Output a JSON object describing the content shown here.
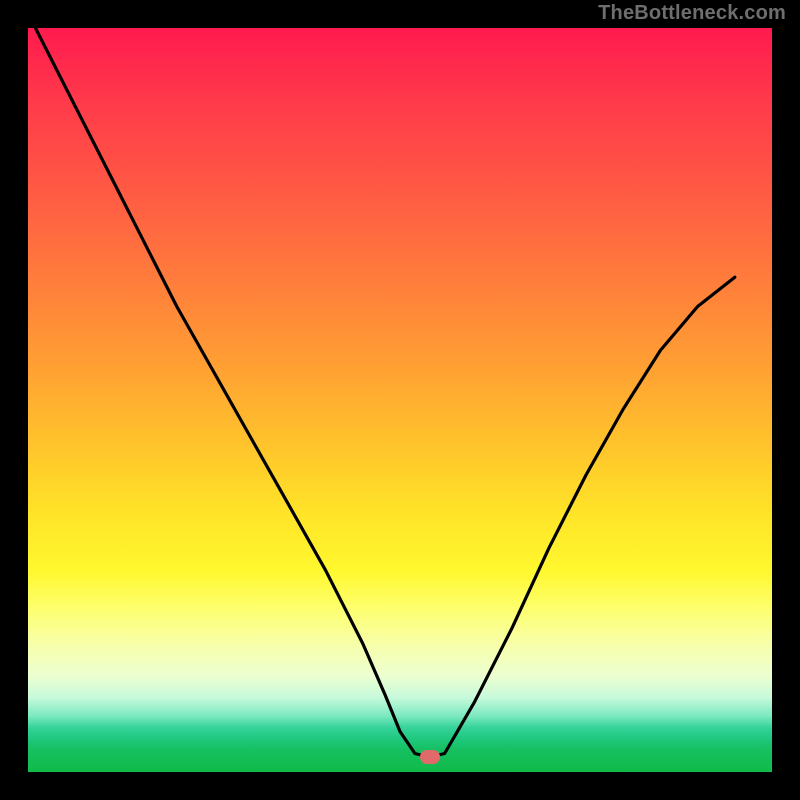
{
  "watermark": "TheBottleneck.com",
  "chart_data": {
    "type": "line",
    "title": "",
    "xlabel": "",
    "ylabel": "",
    "xlim": [
      0,
      100
    ],
    "ylim": [
      0,
      100
    ],
    "grid": false,
    "series": [
      {
        "name": "bottleneck-curve",
        "x": [
          0,
          5,
          10,
          15,
          20,
          25,
          30,
          35,
          40,
          45,
          48,
          50,
          52,
          54,
          56,
          60,
          65,
          70,
          75,
          80,
          85,
          90,
          95
        ],
        "y": [
          102,
          92,
          82,
          72,
          62,
          53,
          44,
          35,
          26,
          16,
          9,
          4,
          1,
          0.5,
          1,
          8,
          18,
          29,
          39,
          48,
          56,
          62,
          66
        ]
      }
    ],
    "annotations": [
      {
        "name": "optimal-point-marker",
        "x": 54,
        "y": 0.5,
        "color": "#e06a6a"
      }
    ],
    "background_gradient": {
      "direction": "vertical",
      "stops": [
        {
          "pos": 0.0,
          "color": "#ff1a4f"
        },
        {
          "pos": 0.55,
          "color": "#ffc02c"
        },
        {
          "pos": 0.78,
          "color": "#fdff6e"
        },
        {
          "pos": 0.93,
          "color": "#37d39b"
        },
        {
          "pos": 1.0,
          "color": "#10ba49"
        }
      ]
    }
  }
}
